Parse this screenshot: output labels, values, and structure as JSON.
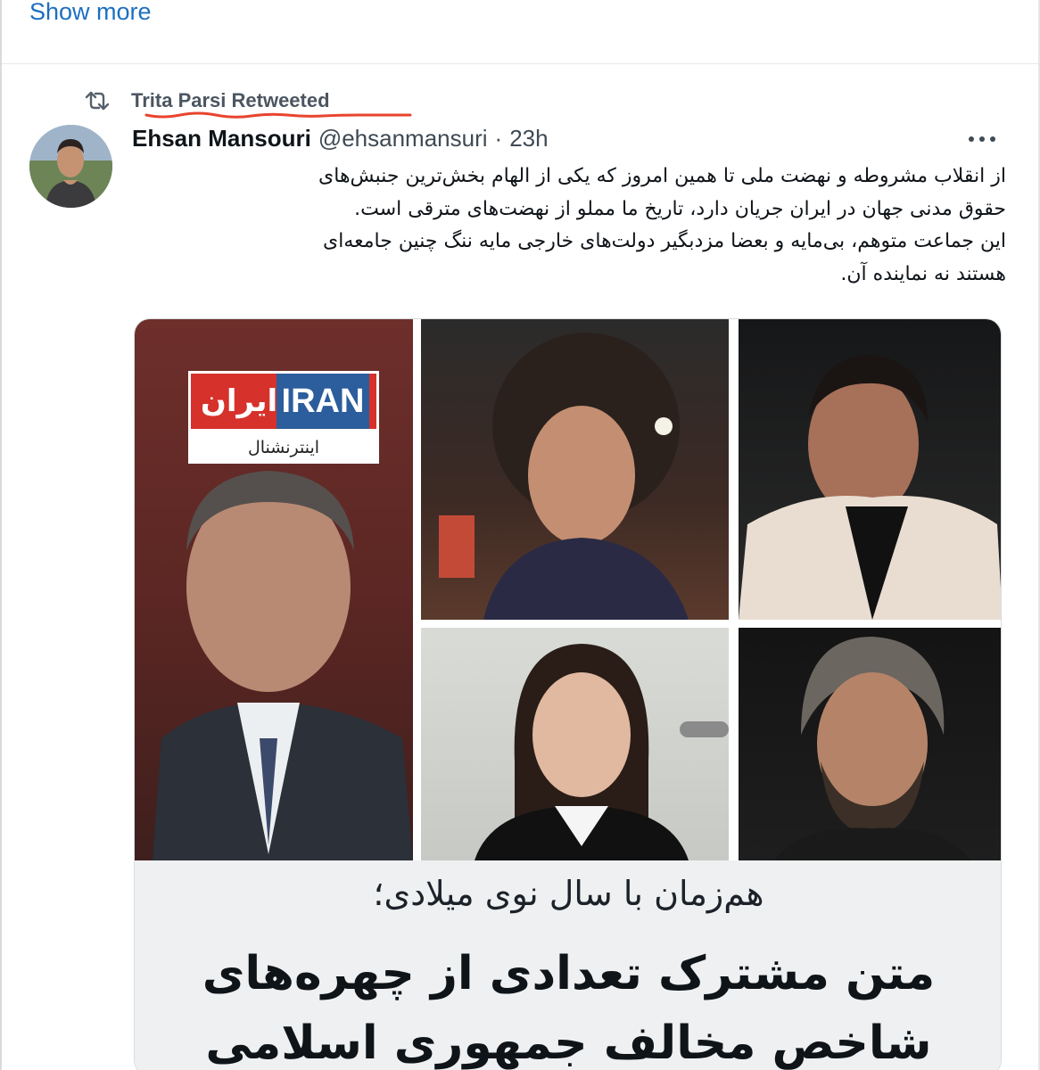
{
  "show_more": {
    "label": "Show more"
  },
  "retweet": {
    "label": "Trita Parsi Retweeted",
    "underline_color": "#e8442e"
  },
  "tweet": {
    "author_name": "Ehsan Mansouri",
    "author_handle": "@ehsanmansuri",
    "separator": "·",
    "time": "23h",
    "text_lines": [
      "از انقلاب مشروطه و نهضت ملی تا همین امروز که یکی از الهام بخش‌ترین جنبش‌های",
      "حقوق مدنی جهان در ایران جریان دارد، تاریخ ما مملو از نهضت‌های مترقی است.",
      "این جماعت متوهم، بی‌مایه و بعضا مزدبگیر دولت‌های خارجی مایه ننگ چنین جامعه‌ای",
      "هستند نه نماینده آن."
    ]
  },
  "media": {
    "logo": {
      "latin": "IRAN",
      "arabic": "ایران",
      "sub": "اینترنشنال"
    },
    "caption_sub": "هم‌زمان با سال نوی میلادی؛",
    "caption_main_lines": [
      "متن مشترک تعدادی از چهره‌های",
      "شاخص مخالف جمهوری اسلامی"
    ]
  },
  "colors": {
    "link": "#1d6fc0",
    "logo_red": "#d6312b",
    "logo_blue": "#2c5d9c",
    "text": "#0f1419",
    "secondary": "#3f4a54"
  },
  "icons": [
    "retweet-icon",
    "more-icon"
  ]
}
